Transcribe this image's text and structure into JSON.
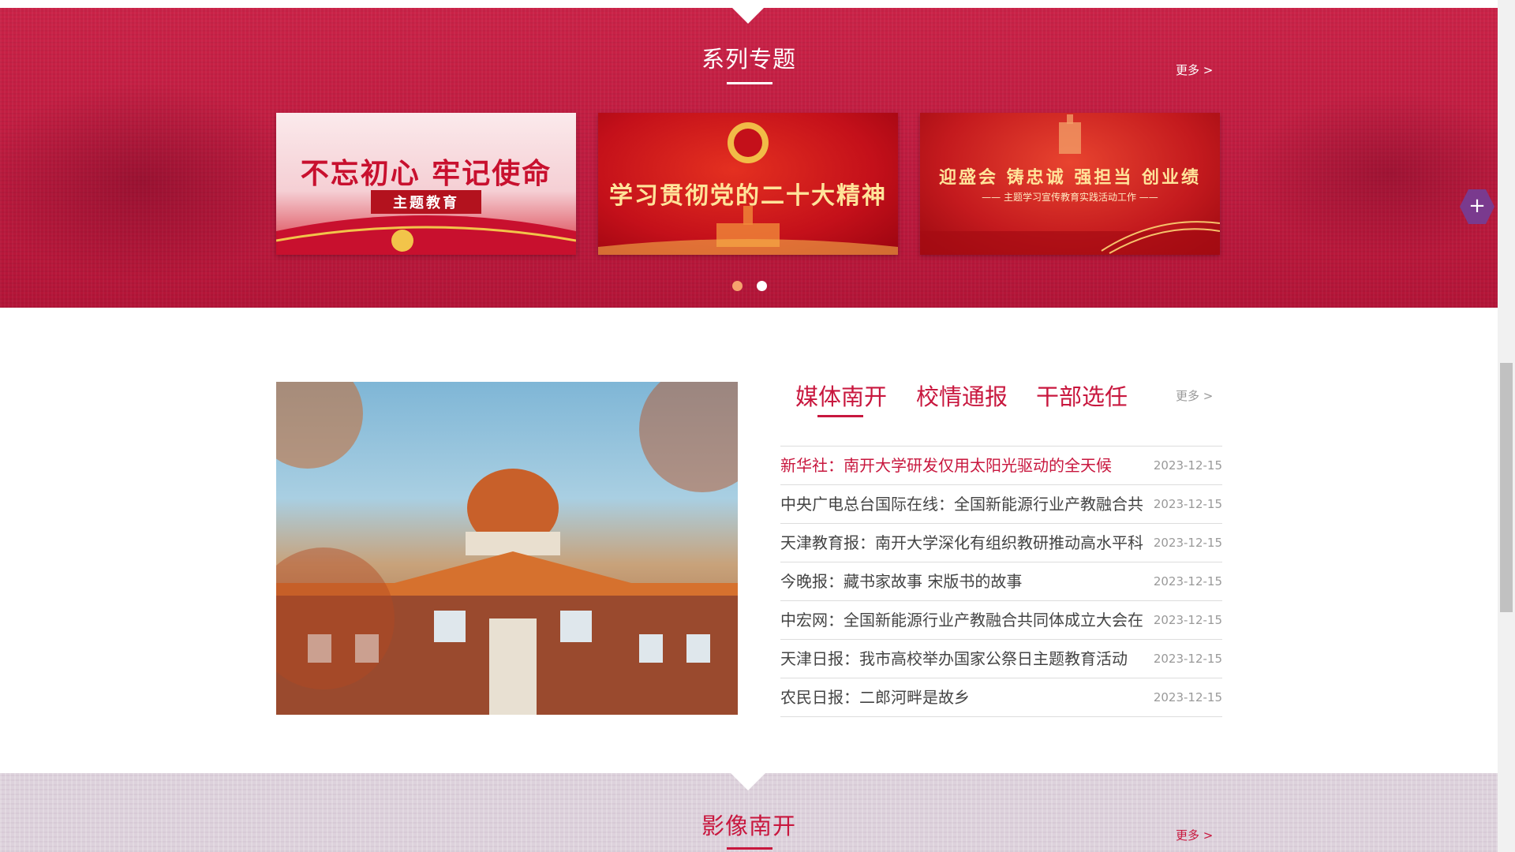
{
  "series": {
    "title": "系列专题",
    "more": "更多 >",
    "slides": [
      {
        "main": "不忘初心 牢记使命",
        "sub": "主题教育"
      },
      {
        "main": "学习贯彻党的二十大精神",
        "sub": ""
      },
      {
        "main": "迎盛会 铸忠诚 强担当 创业绩",
        "sub": "—— 主题学习宣传教育实践活动工作 ——"
      }
    ],
    "pagination": {
      "count": 2,
      "active": 2
    }
  },
  "float_button": {
    "label": "+"
  },
  "news": {
    "tabs": [
      "媒体南开",
      "校情通报",
      "干部选任"
    ],
    "active_tab": 0,
    "more": "更多 >",
    "items": [
      {
        "title": "新华社：南开大学研发仅用太阳光驱动的全天候",
        "date": "2023-12-15"
      },
      {
        "title": "中央广电总台国际在线：全国新能源行业产教融合共",
        "date": "2023-12-15"
      },
      {
        "title": "天津教育报：南开大学深化有组织教研推动高水平科",
        "date": "2023-12-15"
      },
      {
        "title": "今晚报：藏书家故事 宋版书的故事",
        "date": "2023-12-15"
      },
      {
        "title": "中宏网：全国新能源行业产教融合共同体成立大会在",
        "date": "2023-12-15"
      },
      {
        "title": "天津日报：我市高校举办国家公祭日主题教育活动",
        "date": "2023-12-15"
      },
      {
        "title": "农民日报：二郎河畔是故乡",
        "date": "2023-12-15"
      }
    ]
  },
  "images_section": {
    "title": "影像南开",
    "more": "更多 >"
  },
  "colors": {
    "brand_red": "#c8173e",
    "text_gray": "#444444",
    "date_gray": "#999999",
    "float_purple": "#7a3a8e"
  }
}
